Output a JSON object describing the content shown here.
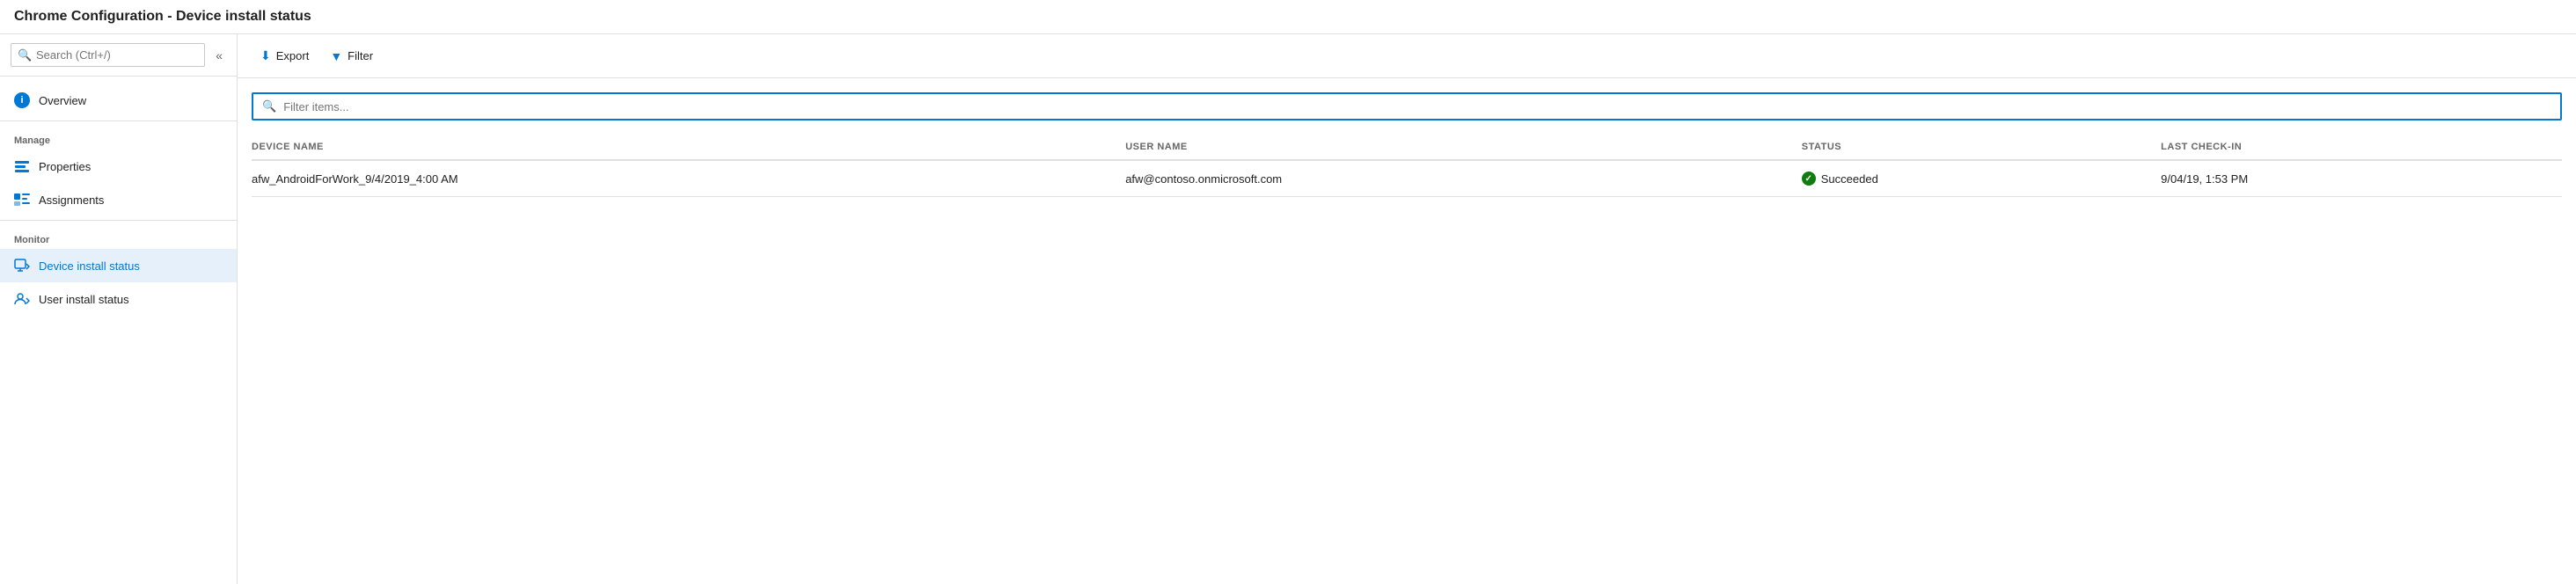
{
  "title": "Chrome Configuration - Device install status",
  "sidebar": {
    "search_placeholder": "Search (Ctrl+/)",
    "collapse_label": "«",
    "sections": [
      {
        "items": [
          {
            "id": "overview",
            "label": "Overview",
            "icon": "info-icon",
            "active": false
          }
        ]
      },
      {
        "label": "Manage",
        "items": [
          {
            "id": "properties",
            "label": "Properties",
            "icon": "properties-icon",
            "active": false
          },
          {
            "id": "assignments",
            "label": "Assignments",
            "icon": "assignments-icon",
            "active": false
          }
        ]
      },
      {
        "label": "Monitor",
        "items": [
          {
            "id": "device-install-status",
            "label": "Device install status",
            "icon": "device-icon",
            "active": true
          },
          {
            "id": "user-install-status",
            "label": "User install status",
            "icon": "user-icon",
            "active": false
          }
        ]
      }
    ]
  },
  "toolbar": {
    "export_label": "Export",
    "filter_label": "Filter"
  },
  "filter": {
    "placeholder": "Filter items..."
  },
  "table": {
    "columns": [
      {
        "id": "device_name",
        "label": "DEVICE NAME"
      },
      {
        "id": "user_name",
        "label": "USER NAME"
      },
      {
        "id": "status",
        "label": "STATUS"
      },
      {
        "id": "last_check_in",
        "label": "LAST CHECK-IN"
      }
    ],
    "rows": [
      {
        "device_name": "afw_AndroidForWork_9/4/2019_4:00 AM",
        "user_name": "afw@contoso.onmicrosoft.com",
        "status": "Succeeded",
        "status_type": "success",
        "last_check_in": "9/04/19, 1:53 PM"
      }
    ]
  },
  "colors": {
    "accent": "#0078d4",
    "success": "#107c10",
    "active_bg": "#e5f0fb"
  }
}
